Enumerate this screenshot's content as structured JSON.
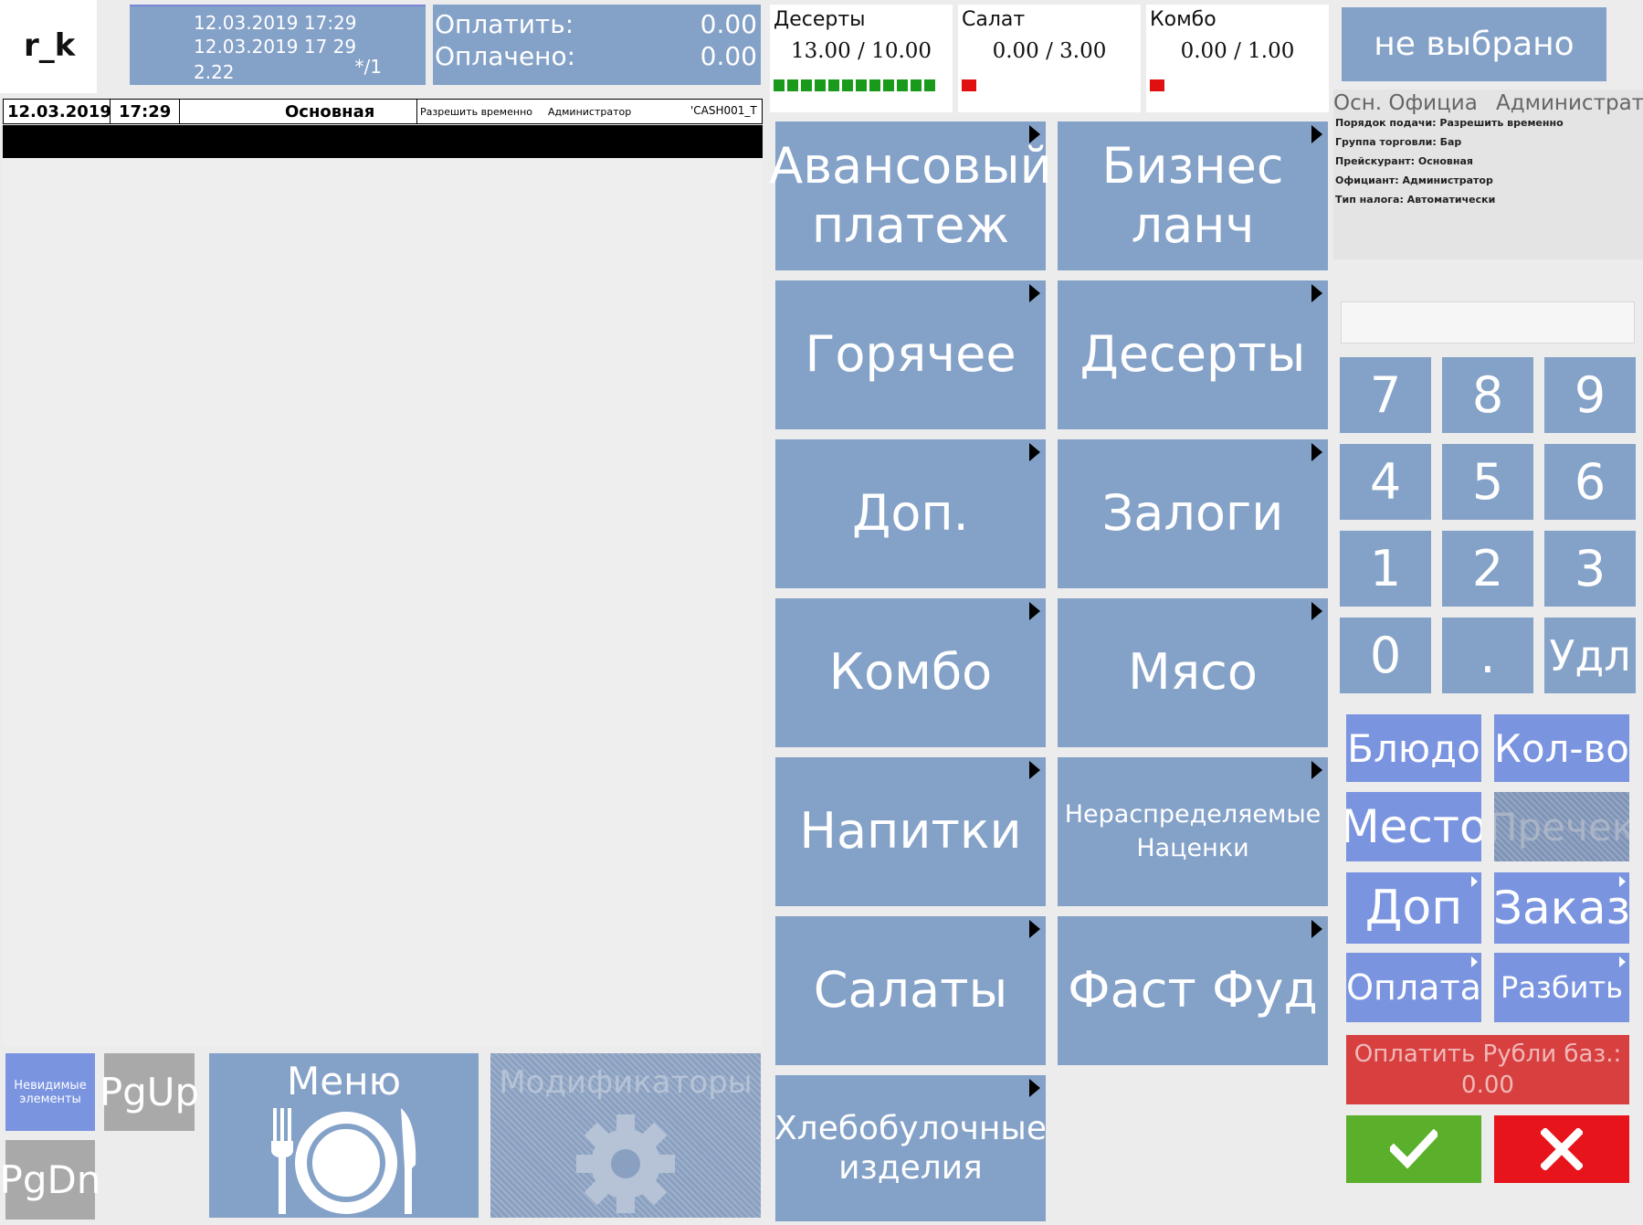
{
  "header": {
    "logo": "r_k",
    "datetime1": "12.03.2019 17:29",
    "datetime2": "12.03.2019 17 29",
    "version": "2.22",
    "seat": "*/1",
    "pay_label": "Оплатить:",
    "pay_value": "0.00",
    "paid_label": "Оплачено:",
    "paid_value": "0.00"
  },
  "counters": [
    {
      "name": "Десерты",
      "value": "13.00 / 10.00",
      "status": "full",
      "color": "#1a9a1a"
    },
    {
      "name": "Салат",
      "value": "0.00 / 3.00",
      "status": "empty",
      "color": "#e01010"
    },
    {
      "name": "Комбо",
      "value": "0.00 / 1.00",
      "status": "empty",
      "color": "#e01010"
    }
  ],
  "order_header": {
    "date": "12.03.2019",
    "time": "17:29",
    "menu": "Основная",
    "flow": "Разрешить временно",
    "user": "Администратор",
    "cash": "'CASH001_T"
  },
  "right_panel": {
    "selected": "не выбрано",
    "waiter_label": "Осн. Официа",
    "waiter_name": "Администратор",
    "info_lines": [
      "Порядок подачи: Разрешить временно",
      "Группа торговли: Бар",
      "Прейскурант: Основная",
      "Официант: Администратор",
      "Тип налога: Автоматически"
    ]
  },
  "categories": [
    "Авансовый платеж",
    "Бизнес ланч",
    "Горячее",
    "Десерты",
    "Доп.",
    "Залоги",
    "Комбо",
    "Мясо",
    "Напитки",
    "Нераспределяемые Наценки",
    "Салаты",
    "Фаст Фуд",
    "Хлебобулочные изделия"
  ],
  "numpad": [
    "7",
    "8",
    "9",
    "4",
    "5",
    "6",
    "1",
    "2",
    "3",
    "0",
    ".",
    "Удл"
  ],
  "actions": {
    "dish": "Блюдо",
    "qty": "Кол-во",
    "place": "Место",
    "precheck": "Пречек",
    "extra": "Доп",
    "order": "Заказ",
    "payment": "Оплата",
    "split": "Разбить",
    "pay_rub": "Оплатить Рубли баз.:",
    "pay_rub_value": "0.00"
  },
  "bottom": {
    "invisible": "Невидимые элементы",
    "pgup": "PgUp",
    "pgdn": "PgDn",
    "menu": "Меню",
    "modifiers": "Модификаторы"
  },
  "colors": {
    "tile": "#84a1c8",
    "action": "#7a94e0",
    "ok": "#5ab02a",
    "cancel": "#e8141c",
    "pay": "#d84040"
  }
}
